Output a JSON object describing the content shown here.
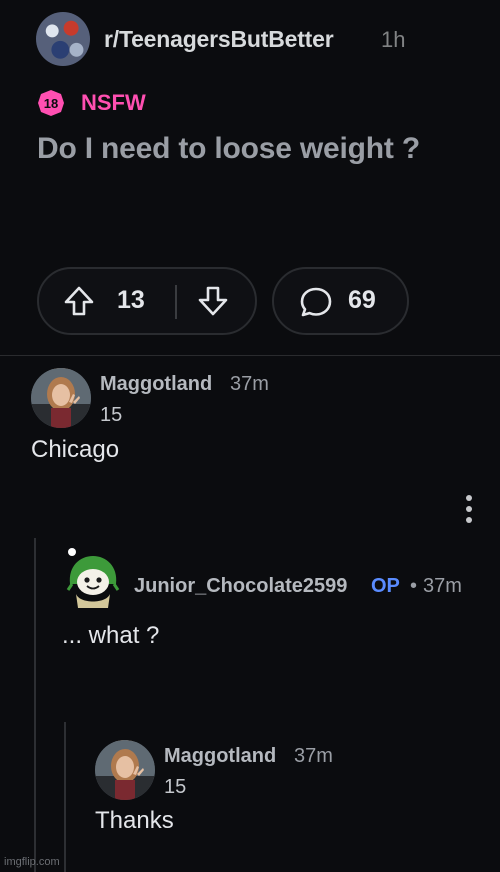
{
  "post": {
    "subreddit": "r/TeenagersButBetter",
    "age": "1h",
    "nsfw_badge": "18",
    "nsfw_label": "NSFW",
    "title": "Do I need to loose weight ?",
    "upvotes": "13",
    "comments": "69"
  },
  "comments": [
    {
      "user": "Maggotland",
      "time": "37m",
      "score": "15",
      "body": "Chicago"
    },
    {
      "user": "Junior_Chocolate2599",
      "op_badge": "OP",
      "dot": "•",
      "time": "37m",
      "body": "... what ?"
    },
    {
      "user": "Maggotland",
      "time": "37m",
      "score": "15",
      "body": "Thanks"
    }
  ],
  "watermark": "imgflip.com",
  "colors": {
    "background": "#0b0c0f",
    "nsfw": "#ff4fb1",
    "op": "#5a8cff",
    "text": "#e4e6ea",
    "muted": "#9a9ea5"
  },
  "icons": [
    "upvote-icon",
    "downvote-icon",
    "comment-bubble-icon",
    "more-options-icon"
  ]
}
